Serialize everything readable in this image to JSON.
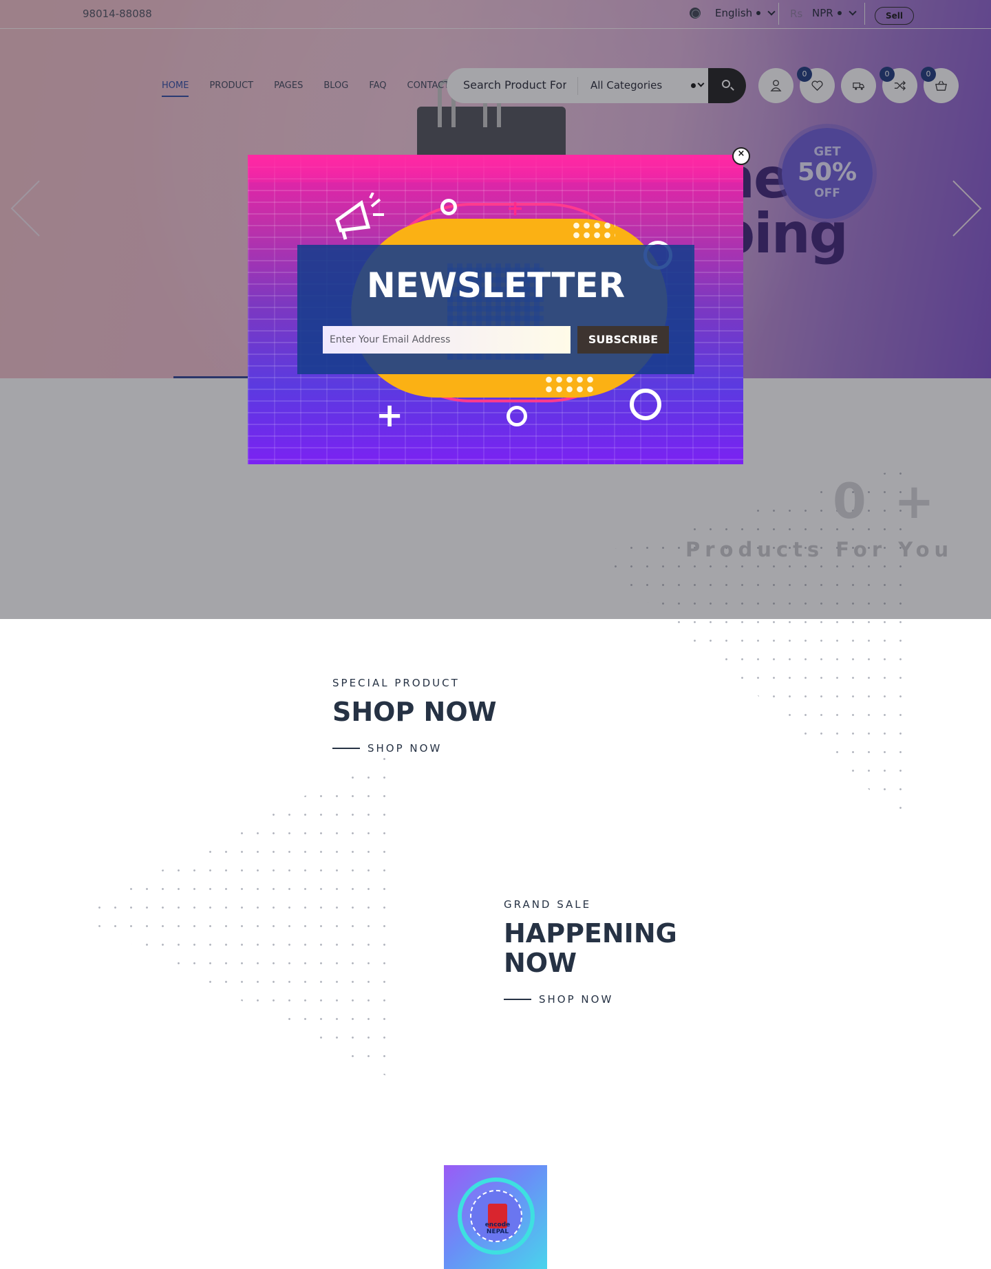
{
  "topbar": {
    "phone": "98014-88088",
    "language": "English",
    "currency_symbol": "Rs",
    "currency": "NPR",
    "sell_label": "Sell"
  },
  "nav": {
    "items": [
      {
        "label": "HOME",
        "active": true
      },
      {
        "label": "PRODUCT",
        "active": false
      },
      {
        "label": "PAGES",
        "active": false
      },
      {
        "label": "BLOG",
        "active": false
      },
      {
        "label": "FAQ",
        "active": false
      },
      {
        "label": "CONTACT",
        "active": false
      }
    ]
  },
  "search": {
    "placeholder": "Search Product For",
    "category": "All Categories"
  },
  "header_icons": {
    "wishlist_count": "0",
    "compare_count": "0",
    "cart_count": "0"
  },
  "hero": {
    "headline_line1": "ne",
    "headline_line2": "ping",
    "badge_top": "GET",
    "badge_percent": "50%",
    "badge_bottom": "OFF"
  },
  "stats": {
    "number": "0 +",
    "caption": "Products For You"
  },
  "promo1": {
    "tag": "SPECIAL PRODUCT",
    "title": "SHOP NOW",
    "link": "SHOP NOW"
  },
  "promo2": {
    "tag": "GRAND SALE",
    "title_line1": "HAPPENING",
    "title_line2": "NOW",
    "link": "SHOP NOW"
  },
  "logo": {
    "line1": "encode",
    "line2": "NEPAL"
  },
  "newsletter": {
    "title": "NEWSLETTER",
    "email_placeholder": "Enter Your Email Address",
    "subscribe_label": "SUBSCRIBE",
    "close_label": "×",
    "qr_label": "Encode"
  },
  "colors": {
    "accent": "#2a47a3",
    "badge_bg": "#17357a",
    "text_dark": "#263244"
  }
}
